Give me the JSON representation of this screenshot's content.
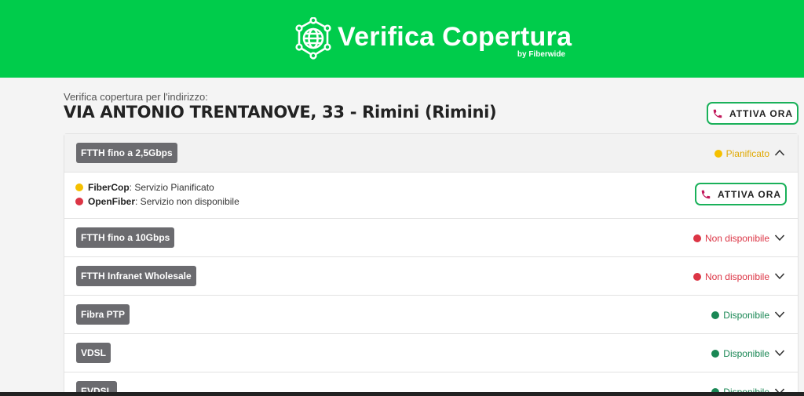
{
  "header": {
    "title": "Verifica Copertura",
    "byline": "by Fiberwide",
    "logo_icon": "globe-network-icon"
  },
  "intro": "Verifica copertura per l'indirizzo:",
  "address": "VIA ANTONIO TRENTANOVE, 33 - Rimini (Rimini)",
  "cta_label": "ATTIVA ORA",
  "colors": {
    "brand_green": "#00cc4b",
    "pianificato": "#f5c000",
    "non_disponibile": "#dc3545",
    "disponibile": "#198754",
    "button_border": "#1ab15a"
  },
  "technologies": [
    {
      "label": "FTTH fino a 2,5Gbps",
      "status": "Pianificato",
      "expanded": true
    },
    {
      "label": "FTTH fino a 10Gbps",
      "status": "Non disponibile",
      "expanded": false
    },
    {
      "label": "FTTH Infranet Wholesale",
      "status": "Non disponibile",
      "expanded": false
    },
    {
      "label": "Fibra PTP",
      "status": "Disponibile",
      "expanded": false
    },
    {
      "label": "VDSL",
      "status": "Disponibile",
      "expanded": false
    },
    {
      "label": "EVDSL",
      "status": "Disponibile",
      "expanded": false
    }
  ],
  "providers": [
    {
      "name": "FiberCop",
      "text": ": Servizio Pianificato",
      "state": "pianificato"
    },
    {
      "name": "OpenFiber",
      "text": ": Servizio non disponibile",
      "state": "non_disponibile"
    }
  ]
}
